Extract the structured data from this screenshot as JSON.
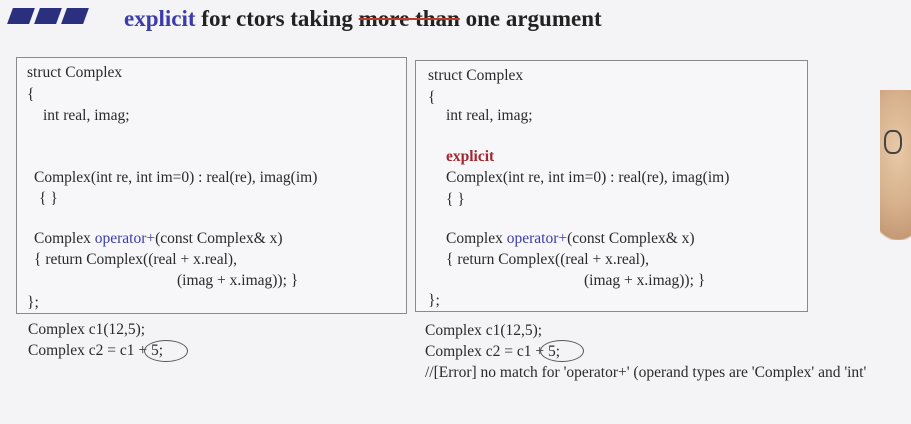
{
  "title": {
    "keyword": "explicit",
    "part1": " for ctors taking ",
    "struck": "more than",
    "part2": " one argument"
  },
  "left": {
    "l1": "struct Complex",
    "l2": "{",
    "l3": "int real, imag;",
    "l4": "Complex(int re, int im=0) : real(re), imag(im)",
    "l5": "{ }",
    "l6a": "Complex ",
    "l6op": "operator+",
    "l6b": "(const Complex& x)",
    "l7": "{ return Complex((real + x.real),",
    "l8": "(imag + x.imag)); }",
    "l9": "};",
    "b1": "Complex c1(12,5);",
    "b2": "Complex c2 = c1 + 5;"
  },
  "right": {
    "l1": "struct Complex",
    "l2": "{",
    "l3": "int real, imag;",
    "explicit": "explicit",
    "l4": "Complex(int re, int im=0) : real(re), imag(im)",
    "l5": "{ }",
    "l6a": "Complex ",
    "l6op": "operator+",
    "l6b": "(const Complex& x)",
    "l7": "{ return Complex((real + x.real),",
    "l8": "(imag + x.imag)); }",
    "l9": "};",
    "b1": "Complex c1(12,5);",
    "b2": "Complex c2 = c1 + 5;",
    "b3": "//[Error] no match for 'operator+' (operand types are 'Complex' and 'int'"
  },
  "colors": {
    "title_bars": "#2a2f7e",
    "keyword": "#3b3baa",
    "explicit": "#a3262f",
    "strike": "#c0392b"
  }
}
